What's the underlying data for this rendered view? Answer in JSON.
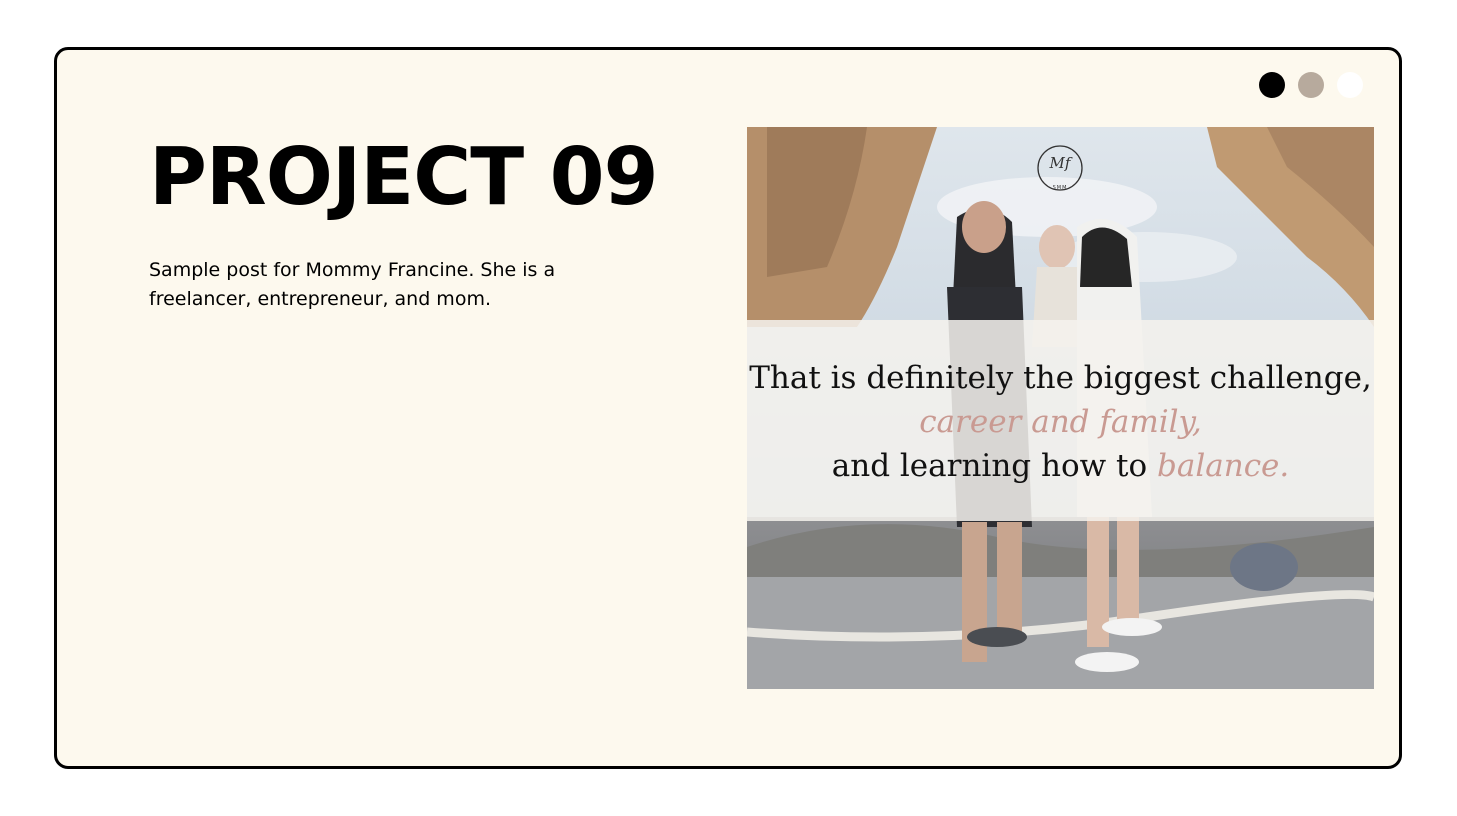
{
  "pagination": {
    "dots": [
      {
        "color": "#000000",
        "state": "active"
      },
      {
        "color": "#b7aa9d",
        "state": "inactive"
      },
      {
        "color": "#ffffff",
        "state": "inactive"
      }
    ]
  },
  "project": {
    "title": "PROJECT 09",
    "description": "Sample post for Mommy Francine. She is a freelancer, entrepreneur, and mom."
  },
  "post": {
    "logo_monogram": "Mf",
    "logo_sub": "SMM",
    "quote_line1": "That is definitely the biggest challenge,",
    "quote_line2": "career and family,",
    "quote_line3_plain": "and learning how to ",
    "quote_line3_accent": "balance.",
    "accent_color": "#c99a92"
  },
  "colors": {
    "frame_background": "#fdf9ee",
    "frame_border": "#000000"
  }
}
